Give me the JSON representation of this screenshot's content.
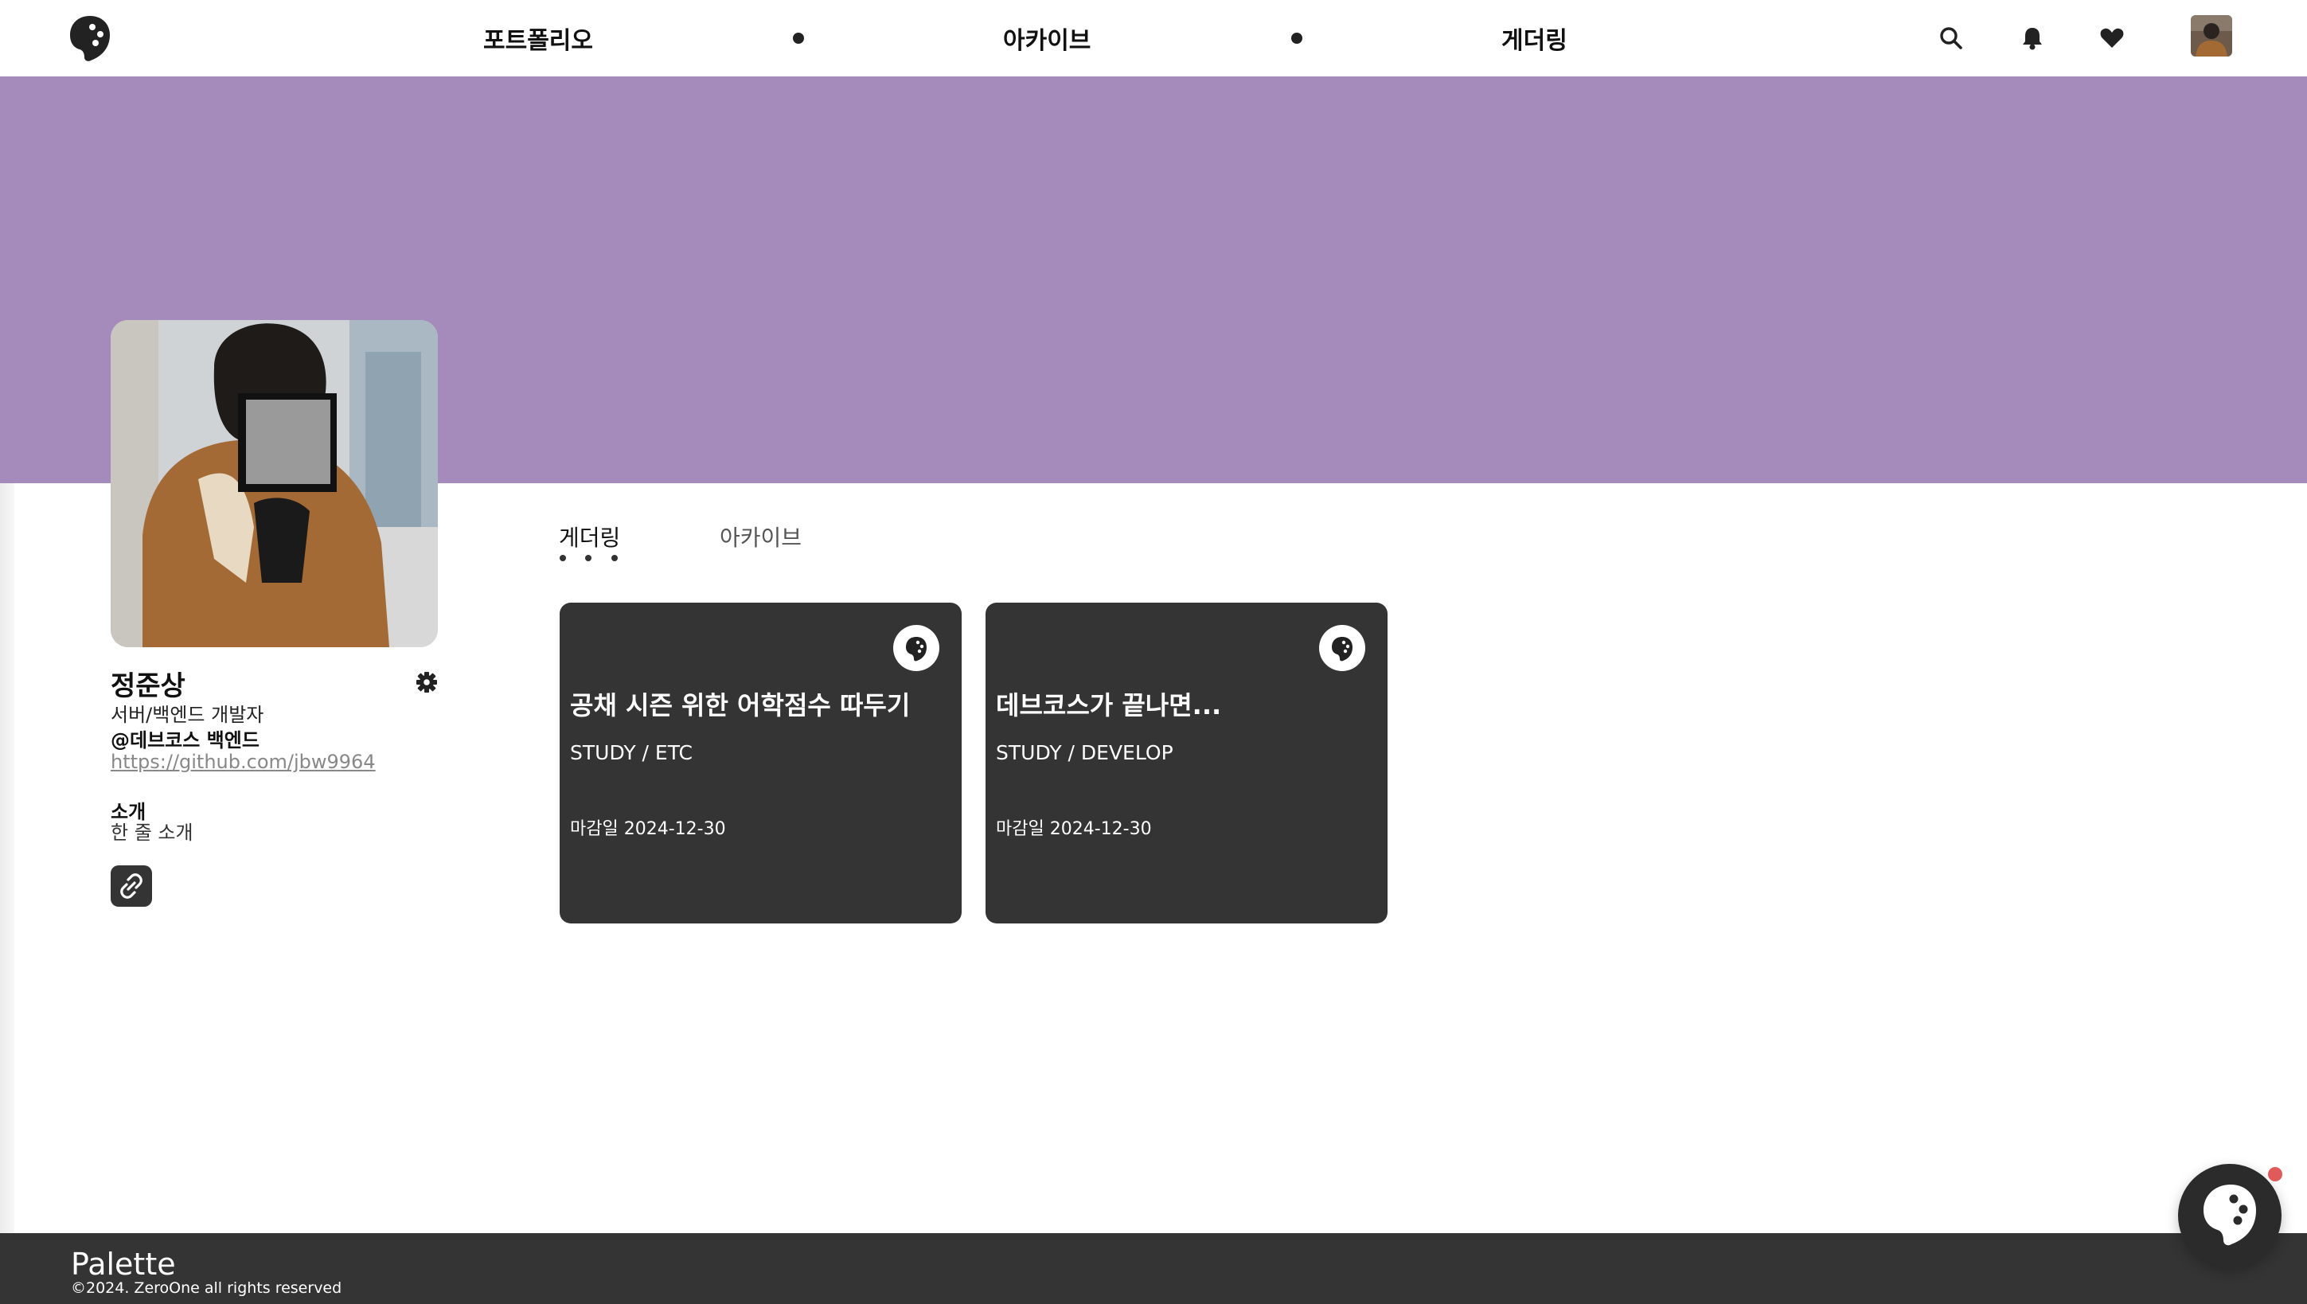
{
  "colors": {
    "banner": "#a48bbb",
    "dark": "#333433",
    "accent_notification": "#e05a5a"
  },
  "header": {
    "nav": [
      "포트폴리오",
      "아카이브",
      "게더링"
    ],
    "icons": [
      "search-icon",
      "bell-icon",
      "heart-icon"
    ]
  },
  "profile": {
    "name": "정준상",
    "role": "서버/백엔드 개발자",
    "org": "@데브코스 백엔드",
    "link": "https://github.com/jbw9964",
    "intro_label": "소개",
    "intro_text": "한 줄 소개"
  },
  "tabs": [
    "게더링",
    "아카이브"
  ],
  "active_tab": "게더링",
  "cards": [
    {
      "title": "공채 시즌 위한 어학점수 따두기",
      "category": "STUDY / ETC",
      "deadline": "마감일 2024-12-30"
    },
    {
      "title": "데브코스가 끝나면...",
      "category": "STUDY / DEVELOP",
      "deadline": "마감일 2024-12-30"
    }
  ],
  "footer": {
    "brand": "Palette",
    "copyright": "©2024. ZeroOne all rights reserved"
  }
}
